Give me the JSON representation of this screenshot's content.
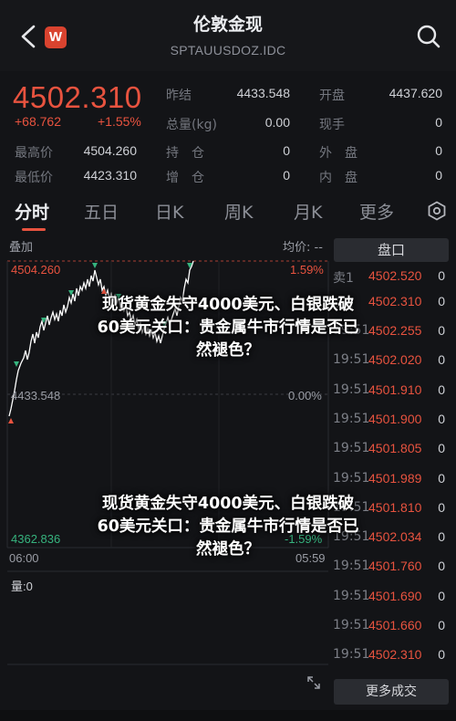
{
  "header": {
    "title": "伦敦金现",
    "subtitle": "SPTAUUSDOZ.IDC",
    "app_badge": "W"
  },
  "quote": {
    "price": "4502.310",
    "change": "+68.762",
    "change_pct": "+1.55%",
    "stats": [
      {
        "label": "昨结",
        "value": "4433.548"
      },
      {
        "label": "开盘",
        "value": "4437.620"
      },
      {
        "label": "总量(kg)",
        "value": "0.00"
      },
      {
        "label": "现手",
        "value": "0"
      },
      {
        "label": "最高价",
        "value": "4504.260"
      },
      {
        "label": "持　仓",
        "value": "0"
      },
      {
        "label": "外　盘",
        "value": "0"
      },
      {
        "label": "最低价",
        "value": "4423.310"
      },
      {
        "label": "增　仓",
        "value": "0"
      },
      {
        "label": "内　盘",
        "value": "0"
      }
    ]
  },
  "tabs": [
    "分时",
    "五日",
    "日K",
    "周K",
    "月K",
    "更多"
  ],
  "chart": {
    "overlay_label": "叠加",
    "avg_label": "均价: --",
    "high_price": "4504.260",
    "high_pct": "1.59%",
    "mid_price": "4433.548",
    "mid_pct": "0.00%",
    "low_price": "4362.836",
    "low_pct": "-1.59%",
    "time_start": "06:00",
    "time_end": "05:59",
    "volume_label": "量:0",
    "colors": {
      "up": "#e8533f",
      "down": "#36b37e",
      "line": "#ffffff"
    }
  },
  "orderbook": {
    "title": "盘口",
    "sell": {
      "label": "卖1",
      "price": "4502.520",
      "qty": "0"
    },
    "buy": {
      "label": "买1",
      "price": "4502.310",
      "qty": "0"
    },
    "trades": [
      {
        "time": "19:51",
        "price": "4502.255",
        "qty": "0"
      },
      {
        "time": "19:51",
        "price": "4502.020",
        "qty": "0"
      },
      {
        "time": "19:51",
        "price": "4501.910",
        "qty": "0"
      },
      {
        "time": "19:51",
        "price": "4501.900",
        "qty": "0"
      },
      {
        "time": "19:51",
        "price": "4501.805",
        "qty": "0"
      },
      {
        "time": "19:51",
        "price": "4501.989",
        "qty": "0"
      },
      {
        "time": "19:51",
        "price": "4501.810",
        "qty": "0"
      },
      {
        "time": "19:51",
        "price": "4502.034",
        "qty": "0"
      },
      {
        "time": "19:51",
        "price": "4501.760",
        "qty": "0"
      },
      {
        "time": "19:51",
        "price": "4501.690",
        "qty": "0"
      },
      {
        "time": "19:51",
        "price": "4501.660",
        "qty": "0"
      },
      {
        "time": "19:51",
        "price": "4502.310",
        "qty": "0"
      }
    ],
    "more_label": "更多成交"
  },
  "headline": {
    "line1": "现货黄金失守4000美元、白银跌破",
    "line2": "60美元关口：贵金属牛市行情是否已",
    "line3": "然褪色？"
  }
}
